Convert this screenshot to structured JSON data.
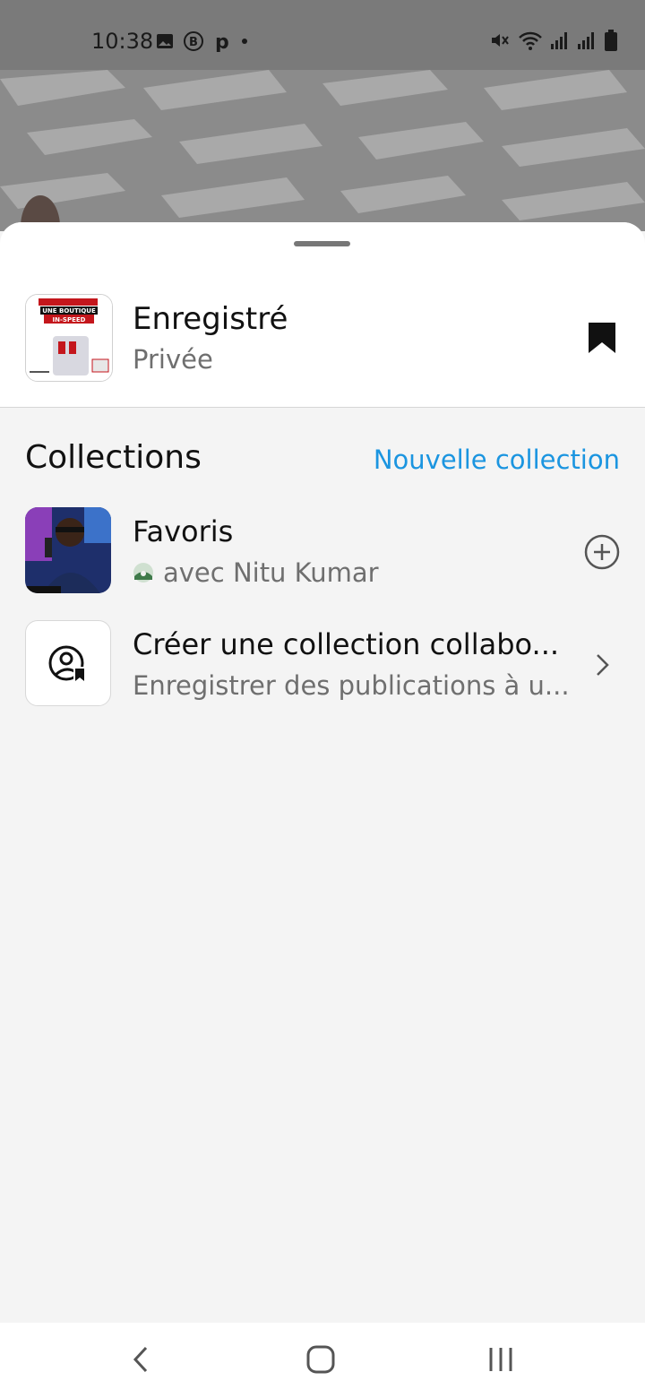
{
  "status_bar": {
    "time": "10:38",
    "icons_left": [
      "gallery-icon",
      "b-badge-icon",
      "p-app-icon",
      "dot-icon"
    ],
    "icons_right": [
      "mute-icon",
      "wifi-icon",
      "signal-icon",
      "signal-icon",
      "battery-icon"
    ]
  },
  "sheet": {
    "saved": {
      "title": "Enregistré",
      "subtitle": "Privée",
      "thumb_text_1": "UNE BOUTIQUE",
      "thumb_text_2": "IN-SPEED"
    },
    "collections_header": "Collections",
    "new_collection_label": "Nouvelle collection",
    "items": [
      {
        "title": "Favoris",
        "subtitle": "avec Nitu Kumar",
        "action": "plus-icon"
      },
      {
        "title": "Créer une collection collabo...",
        "subtitle": "Enregistrer des publications à u...",
        "action": "chevron-right-icon"
      }
    ]
  },
  "colors": {
    "accent": "#1b95e0",
    "text": "#111111",
    "muted": "#6f6f6f"
  },
  "nav": {
    "icons": [
      "back-icon",
      "home-icon",
      "recent-apps-icon"
    ]
  }
}
